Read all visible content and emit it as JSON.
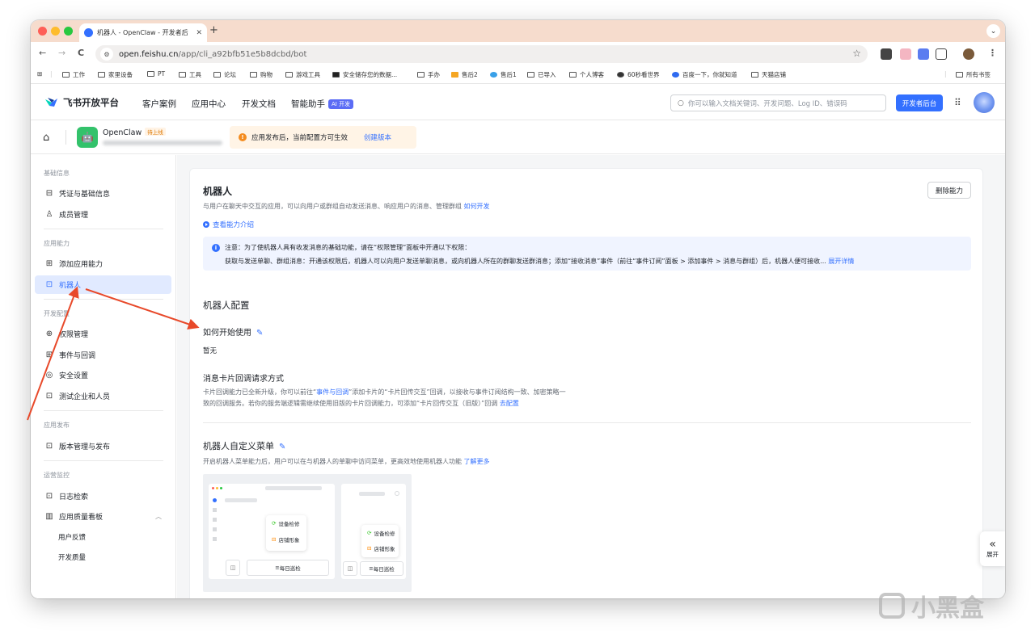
{
  "browser": {
    "tab_title": "机器人 - OpenClaw - 开发者后",
    "tab_close": "✕",
    "new_tab": "+",
    "tab_menu": "⌄",
    "url_host": "open.feishu.cn",
    "url_path": "/app/cli_a92bfb51e5b8dcbd/bot",
    "nav": {
      "back": "←",
      "forward": "→",
      "reload": "C"
    },
    "menu": "⋮"
  },
  "bookmarks": [
    {
      "label": "工作",
      "folder": true
    },
    {
      "label": "家里设备",
      "folder": true
    },
    {
      "label": "PT",
      "folder": true
    },
    {
      "label": "工具",
      "folder": true
    },
    {
      "label": "论坛",
      "folder": true
    },
    {
      "label": "购物",
      "folder": true
    },
    {
      "label": "游戏工具",
      "folder": true
    },
    {
      "label": "安全储存您的数据...",
      "folder": false
    },
    {
      "label": "手办",
      "folder": true
    },
    {
      "label": "售后2",
      "folder": false
    },
    {
      "label": "售后1",
      "folder": false
    },
    {
      "label": "已导入",
      "folder": true
    },
    {
      "label": "个人博客",
      "folder": true
    },
    {
      "label": "60秒看世界",
      "folder": false
    },
    {
      "label": "百度一下，你就知道",
      "folder": false
    },
    {
      "label": "天猫店铺",
      "folder": true
    }
  ],
  "bookmarks_all": "所有书签",
  "header": {
    "brand": "飞书开放平台",
    "nav": [
      "客户案例",
      "应用中心",
      "开发文档",
      "智能助手"
    ],
    "ai_badge": "AI 开发",
    "search_placeholder": "你可以输入文档关键词、开发问题、Log ID、错误码",
    "dev_console": "开发者后台"
  },
  "app": {
    "name": "OpenClaw",
    "status": "待上线",
    "notice": "应用发布后，当前配置方可生效",
    "notice_link": "创建版本"
  },
  "sidebar": {
    "groups": [
      "基础信息",
      "应用能力",
      "开发配置",
      "应用发布",
      "运营监控"
    ],
    "items": [
      "凭证与基础信息",
      "成员管理",
      "添加应用能力",
      "机器人",
      "权限管理",
      "事件与回调",
      "安全设置",
      "测试企业和人员",
      "版本管理与发布",
      "日志检索",
      "应用质量看板"
    ],
    "sub_items": [
      "用户反馈",
      "开发质量"
    ]
  },
  "main": {
    "title": "机器人",
    "desc": "与用户在聊天中交互的应用，可以向用户或群组自动发送消息、响应用户的消息、管理群组",
    "desc_link": "如何开发",
    "delete_btn": "删除能力",
    "intro_link": "查看能力介绍",
    "info_line1": "注意：为了使机器人具有收发消息的基础功能，请在“权限管理”面板中开通以下权限：",
    "info_line2": "获取与发送单聊、群组消息：开通该权限后，机器人可以向用户发送单聊消息，或向机器人所在的群聊发送群消息；添加“接收消息”事件（前往“事件订阅”面板 > 添加事件 > 消息与群组）后，机器人便可接收...",
    "info_link": "展开详情",
    "config_title": "机器人配置",
    "getting_started": "如何开始使用",
    "none": "暂无",
    "card_callback_title": "消息卡片回调请求方式",
    "card_callback_desc1_a": "卡片回调能力已全新升级，你可以前往“",
    "card_callback_desc1_link": "事件与回调",
    "card_callback_desc1_b": "”添加卡片的“卡片回传交互”回调，以接收与事件订阅结构一致、加密策略一",
    "card_callback_desc2": "致的回调服务。若你的服务端逻辑需继续使用旧版的卡片回调能力，可添加“卡片回传交互（旧版）”回调",
    "card_callback_link": "去配置",
    "menu_title": "机器人自定义菜单",
    "menu_desc": "开启机器人菜单能力后，用户可以在与机器人的单聊中访问菜单，更高效地使用机器人功能",
    "menu_desc_link": "了解更多",
    "preview": {
      "item1": "设备检修",
      "item2": "店铺形象",
      "button": "每日巡检"
    }
  },
  "expand": {
    "chevron": "«",
    "label": "展开"
  },
  "watermark": "小黑盒",
  "colors": {
    "accent": "#3370ff",
    "annotation": "#e8492a",
    "tab_strip": "#f6dccd"
  }
}
